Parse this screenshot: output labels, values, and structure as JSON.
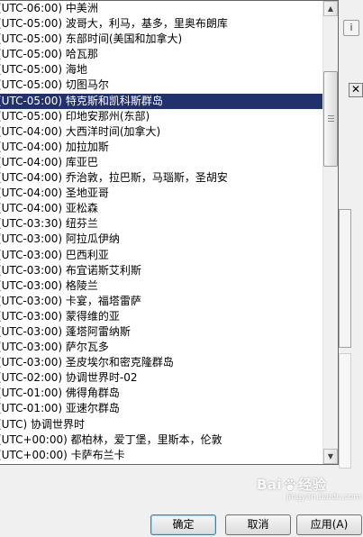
{
  "timezone_list": {
    "selected_index": 6,
    "items": [
      "(UTC-06:00) 中美洲",
      "(UTC-05:00) 波哥大，利马，基多，里奥布朗库",
      "(UTC-05:00) 东部时间(美国和加拿大)",
      "(UTC-05:00) 哈瓦那",
      "(UTC-05:00) 海地",
      "(UTC-05:00) 切图马尔",
      "(UTC-05:00) 特克斯和凯科斯群岛",
      "(UTC-05:00) 印地安那州(东部)",
      "(UTC-04:00) 大西洋时间(加拿大)",
      "(UTC-04:00) 加拉加斯",
      "(UTC-04:00) 库亚巴",
      "(UTC-04:00) 乔治敦，拉巴斯，马瑙斯，圣胡安",
      "(UTC-04:00) 圣地亚哥",
      "(UTC-04:00) 亚松森",
      "(UTC-03:30) 纽芬兰",
      "(UTC-03:00) 阿拉瓜伊纳",
      "(UTC-03:00) 巴西利亚",
      "(UTC-03:00) 布宜诺斯艾利斯",
      "(UTC-03:00) 格陵兰",
      "(UTC-03:00) 卡宴，福塔雷萨",
      "(UTC-03:00) 蒙得维的亚",
      "(UTC-03:00) 蓬塔阿雷纳斯",
      "(UTC-03:00) 萨尔瓦多",
      "(UTC-03:00) 圣皮埃尔和密克隆群岛",
      "(UTC-02:00) 协调世界时-02",
      "(UTC-01:00) 佛得角群岛",
      "(UTC-01:00) 亚速尔群岛",
      "(UTC) 协调世界时",
      "(UTC+00:00) 都柏林，爱丁堡，里斯本，伦敦",
      "(UTC+00:00) 卡萨布兰卡"
    ]
  },
  "dialog": {
    "help_label": "i",
    "close_label": "✕",
    "ok_label": "确定",
    "cancel_label": "取消",
    "apply_label": "应用(A)"
  },
  "watermark": {
    "text_left": "Bai",
    "text_right": "经验",
    "subtext": "jingyan.baidu.com"
  },
  "colors": {
    "selection": "#22306c",
    "list_bg": "#ffffff",
    "dialog_bg": "#f0f0f0"
  }
}
